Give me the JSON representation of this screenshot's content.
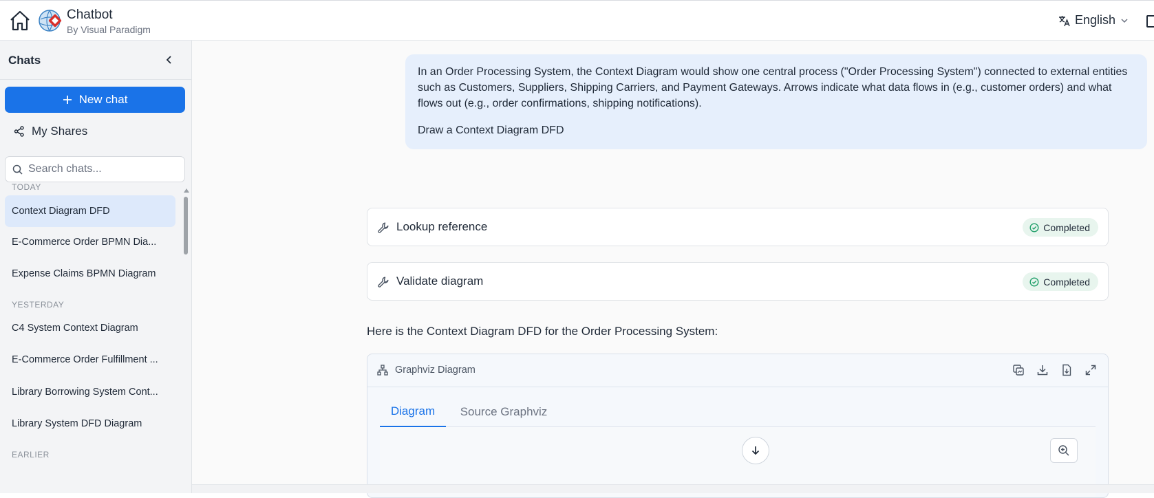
{
  "header": {
    "title": "Chatbot",
    "subtitle": "By Visual Paradigm",
    "language": "English"
  },
  "sidebar": {
    "title": "Chats",
    "new_chat_label": "New chat",
    "my_shares_label": "My Shares",
    "search_placeholder": "Search chats...",
    "groups": {
      "today": "TODAY",
      "yesterday": "YESTERDAY",
      "earlier": "EARLIER"
    },
    "items": [
      {
        "label": "Context Diagram DFD"
      },
      {
        "label": "E-Commerce Order BPMN Dia..."
      },
      {
        "label": "Expense Claims BPMN Diagram"
      },
      {
        "label": "C4 System Context Diagram"
      },
      {
        "label": "E-Commerce Order Fulfillment ..."
      },
      {
        "label": "Library Borrowing System Cont..."
      },
      {
        "label": "Library System DFD Diagram"
      }
    ]
  },
  "conversation": {
    "user_message": {
      "paragraph1": "In an Order Processing System, the Context Diagram would show one central process (\"Order Processing System\") connected to external entities such as Customers, Suppliers, Shipping Carriers, and Payment Gateways. Arrows indicate what data flows in (e.g., customer orders) and what flows out (e.g., order confirmations, shipping notifications).",
      "paragraph2": "Draw a Context Diagram DFD"
    },
    "tools": [
      {
        "name": "Lookup reference",
        "status": "Completed"
      },
      {
        "name": "Validate diagram",
        "status": "Completed"
      }
    ],
    "answer_text": "Here is the Context Diagram DFD for the Order Processing System:",
    "diagram": {
      "header_title": "Graphviz Diagram",
      "tabs": [
        "Diagram",
        "Source Graphviz"
      ]
    }
  },
  "colors": {
    "accent": "#1a73e8",
    "user_bubble": "#e6effc",
    "success": "#22a06b"
  }
}
